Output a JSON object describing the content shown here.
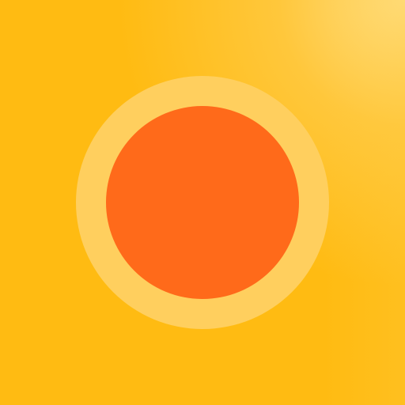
{
  "icon": {
    "name": "orange-circle-icon",
    "colors": {
      "background": "#FFBB12",
      "ring": "#FFCF5E",
      "disc": "#FF6A1A"
    }
  }
}
